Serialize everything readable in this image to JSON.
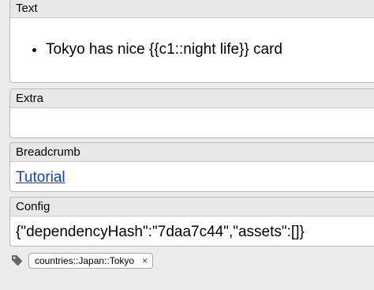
{
  "fields": {
    "text": {
      "label": "Text",
      "bullet": "Tokyo has nice {{c1::night life}} card"
    },
    "extra": {
      "label": "Extra",
      "value": ""
    },
    "breadcrumb": {
      "label": "Breadcrumb",
      "link": "Tutorial"
    },
    "config": {
      "label": "Config",
      "value": "{\"dependencyHash\":\"7daa7c44\",\"assets\":[]}"
    }
  },
  "tags": {
    "icon": "tag-icon",
    "items": [
      {
        "label": "countries::Japan::Tokyo",
        "close": "×"
      }
    ]
  }
}
